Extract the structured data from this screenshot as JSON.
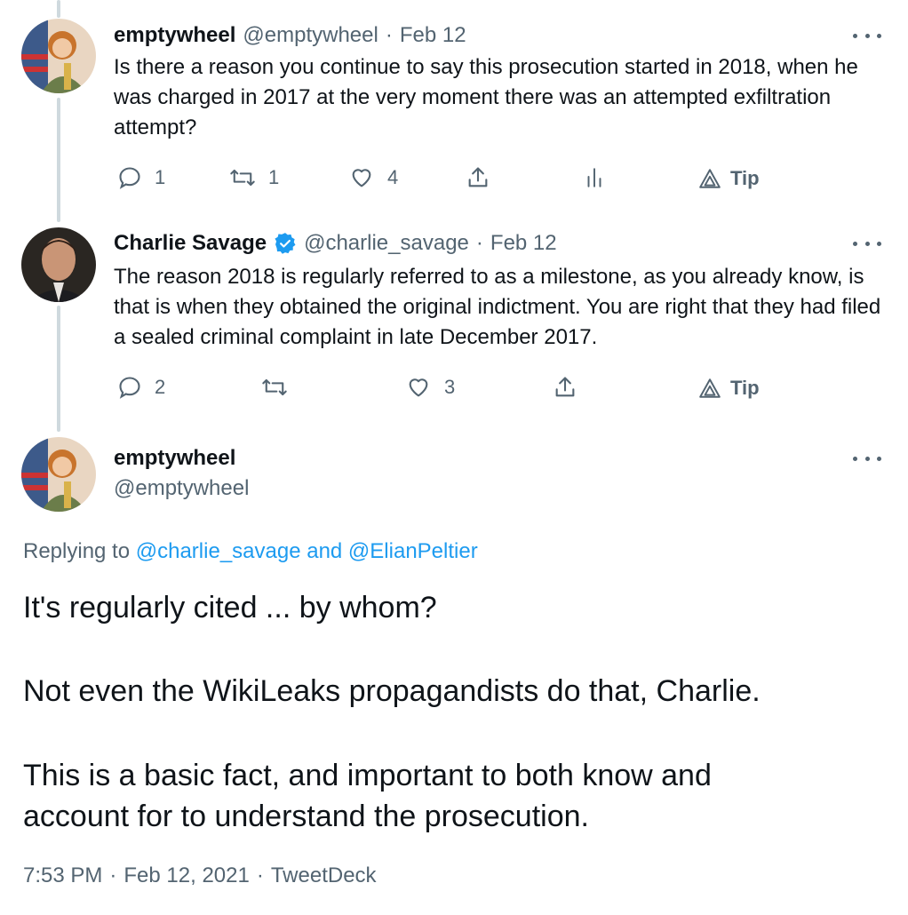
{
  "tweets": [
    {
      "name": "emptywheel",
      "handle": "@emptywheel",
      "separator": "·",
      "date": "Feb 12",
      "text": "Is there a reason you continue to say this prosecution started in 2018, when he was charged in 2017 at the very moment there was an attempted exfiltration attempt?",
      "actions": {
        "reply_count": "1",
        "retweet_count": "1",
        "like_count": "4",
        "tip_label": "Tip"
      }
    },
    {
      "name": "Charlie Savage",
      "verified": true,
      "handle": "@charlie_savage",
      "separator": "·",
      "date": "Feb 12",
      "text": "The reason 2018 is regularly referred to as a milestone, as you already know, is that is when they obtained the original indictment. You are right that they had filed a sealed criminal complaint in late December 2017.",
      "actions": {
        "reply_count": "2",
        "retweet_count": "",
        "like_count": "3",
        "tip_label": "Tip"
      }
    }
  ],
  "main_tweet": {
    "name": "emptywheel",
    "handle": "@emptywheel",
    "replying_prefix": "Replying to",
    "replying_to": "@charlie_savage and @ElianPeltier",
    "paragraphs": [
      "It's regularly cited ... by whom?",
      "Not even the WikiLeaks propagandists do that, Charlie.",
      "This is a basic fact, and important to both know and account for to understand the prosecution."
    ],
    "time": "7:53 PM",
    "separator": "·",
    "full_date": "Feb 12, 2021",
    "source": "TweetDeck"
  },
  "colors": {
    "accent": "#1d9bf0",
    "secondary_text": "#536471",
    "thread_line": "#cfd9de"
  }
}
